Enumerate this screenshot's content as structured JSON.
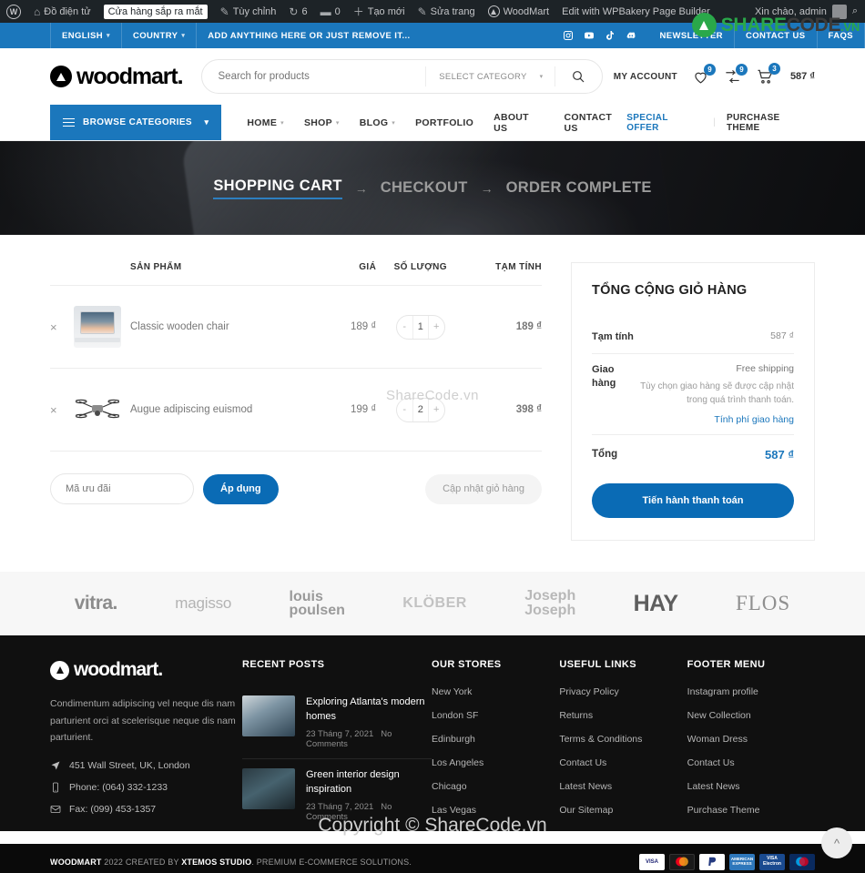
{
  "adminbar": {
    "site_name": "Đồ điện tử",
    "pill": "Cửa hàng sắp ra mắt",
    "customize": "Tùy chỉnh",
    "updates": "6",
    "comments": "0",
    "new": "Tạo mới",
    "edit_page": "Sửa trang",
    "woodmart": "WoodMart",
    "wpbakery": "Edit with WPBakery Page Builder",
    "greeting": "Xin chào, admin"
  },
  "watermark": {
    "brand_a": "SHARE",
    "brand_b": "CODE",
    "brand_c": ".VN",
    "middle": "ShareCode.vn",
    "bottom": "Copyright © ShareCode.vn"
  },
  "topbar": {
    "language": "ENGLISH",
    "country": "COUNTRY",
    "message": "ADD ANYTHING HERE OR JUST REMOVE IT...",
    "socials": [
      "instagram-icon",
      "youtube-icon",
      "tiktok-icon",
      "discord-icon"
    ],
    "links": [
      "NEWSLETTER",
      "CONTACT US",
      "FAQS"
    ]
  },
  "header": {
    "logo_text": "woodmart.",
    "search_placeholder": "Search for products",
    "select_category": "SELECT CATEGORY",
    "my_account": "MY ACCOUNT",
    "wishlist_count": "9",
    "compare_count": "9",
    "cart_count": "3",
    "cart_total": "587 ₫"
  },
  "nav": {
    "browse": "BROWSE CATEGORIES",
    "items": [
      {
        "label": "HOME",
        "has_caret": true
      },
      {
        "label": "SHOP",
        "has_caret": true
      },
      {
        "label": "BLOG",
        "has_caret": true
      },
      {
        "label": "PORTFOLIO",
        "has_caret": false
      },
      {
        "label": "ABOUT US",
        "has_caret": false
      },
      {
        "label": "CONTACT US",
        "has_caret": false
      }
    ],
    "special_offer": "SPECIAL OFFER",
    "purchase_theme": "PURCHASE THEME"
  },
  "hero": {
    "steps": [
      {
        "label": "SHOPPING CART",
        "active": true
      },
      {
        "label": "CHECKOUT",
        "active": false
      },
      {
        "label": "ORDER COMPLETE",
        "active": false
      }
    ],
    "arrow": "→"
  },
  "cart": {
    "headers": {
      "product": "SẢN PHẨM",
      "price": "GIÁ",
      "quantity": "SỐ LƯỢNG",
      "subtotal": "TẠM TÍNH"
    },
    "rows": [
      {
        "remove": "×",
        "image": "laptop-thumbnail",
        "name": "Classic wooden chair",
        "price": "189 ₫",
        "qty": "1",
        "minus": "-",
        "plus": "+",
        "subtotal": "189 ₫"
      },
      {
        "remove": "×",
        "image": "drone-thumbnail",
        "name": "Augue adipiscing euismod",
        "price": "199 ₫",
        "qty": "2",
        "minus": "-",
        "plus": "+",
        "subtotal": "398 ₫"
      }
    ],
    "coupon_placeholder": "Mã ưu đãi",
    "apply_label": "Áp dụng",
    "update_label": "Cập nhật giỏ hàng"
  },
  "totals": {
    "title": "TỔNG CỘNG GIỎ HÀNG",
    "subtotal_label": "Tạm tính",
    "subtotal_value": "587 ₫",
    "shipping_label": "Giao hàng",
    "shipping_option": "Free shipping",
    "shipping_note": "Tùy chọn giao hàng sẽ được cập nhật trong quá trình thanh toán.",
    "shipping_link": "Tính phí giao hàng",
    "total_label": "Tổng",
    "total_value": "587 ₫",
    "checkout_label": "Tiến hành thanh toán"
  },
  "brands": [
    {
      "name": "vitra.",
      "style": "b-vitra"
    },
    {
      "name": "magisso",
      "style": "b-magisso"
    },
    {
      "name": "louis poulsen",
      "style": "b-louis",
      "line1": "louis",
      "line2": "poulsen"
    },
    {
      "name": "KLÖBER",
      "style": "b-klober"
    },
    {
      "name": "Joseph Joseph",
      "style": "b-joseph",
      "line1": "Joseph",
      "line2": "Joseph"
    },
    {
      "name": "HAY",
      "style": "b-hay"
    },
    {
      "name": "FLOS",
      "style": "b-flos"
    }
  ],
  "footer": {
    "logo_text": "woodmart.",
    "description": "Condimentum adipiscing vel neque dis nam parturient orci at scelerisque neque dis nam parturient.",
    "address": "451 Wall Street, UK, London",
    "phone": "Phone: (064) 332-1233",
    "fax": "Fax: (099) 453-1357",
    "recent_posts_title": "RECENT POSTS",
    "posts": [
      {
        "title": "Exploring Atlanta's modern homes",
        "date": "23 Tháng 7, 2021",
        "comments": "No Comments"
      },
      {
        "title": "Green interior design inspiration",
        "date": "23 Tháng 7, 2021",
        "comments": "No Comments"
      }
    ],
    "stores_title": "OUR STORES",
    "stores": [
      "New York",
      "London SF",
      "Edinburgh",
      "Los Angeles",
      "Chicago",
      "Las Vegas"
    ],
    "useful_title": "USEFUL LINKS",
    "useful": [
      "Privacy Policy",
      "Returns",
      "Terms & Conditions",
      "Contact Us",
      "Latest News",
      "Our Sitemap"
    ],
    "menu_title": "FOOTER MENU",
    "menu": [
      "Instagram profile",
      "New Collection",
      "Woman Dress",
      "Contact Us",
      "Latest News",
      "Purchase Theme"
    ]
  },
  "copyright": {
    "brand": "WOODMART",
    "mid": " 2022 CREATED BY ",
    "studio": "XTEMOS STUDIO",
    "tail": ". PREMIUM E-COMMERCE SOLUTIONS.",
    "payments": [
      "VISA",
      "MasterCard",
      "PayPal",
      "AMERICAN EXPRESS",
      "VISA Electron",
      "Maestro"
    ],
    "to_top": "^"
  },
  "colors": {
    "accent": "#1b77bc",
    "button": "#0a6bb5",
    "dark": "#101010",
    "admin": "#1d2327"
  }
}
